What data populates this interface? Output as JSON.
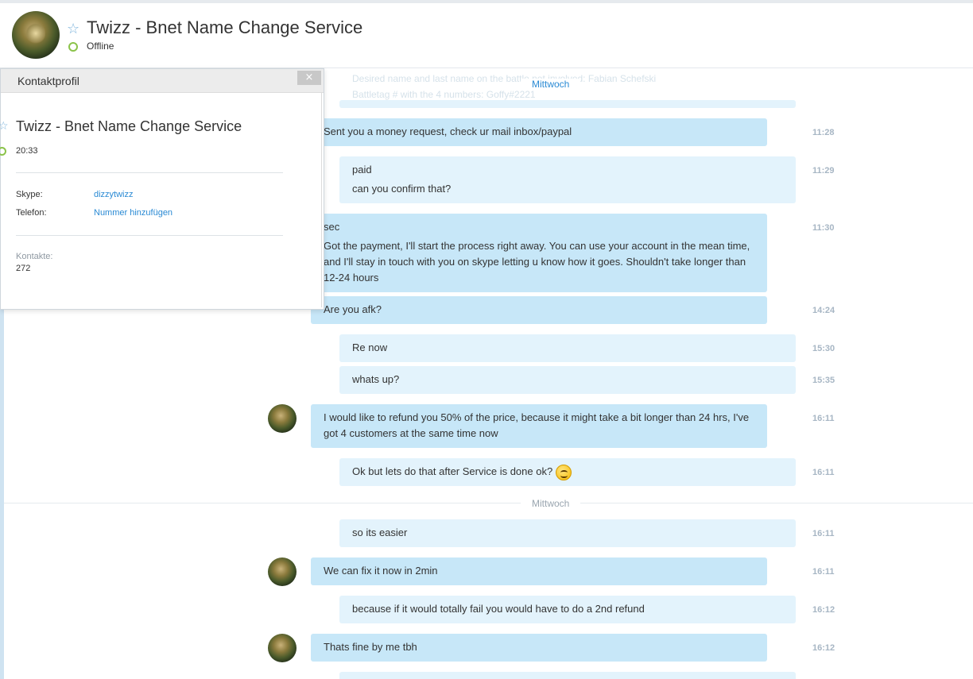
{
  "header": {
    "title": "Twizz - Bnet Name Change Service",
    "status": "Offline",
    "colors": {
      "presence": "#8bc34a",
      "star": "#7fb5dd"
    }
  },
  "profile": {
    "title": "Kontaktprofil",
    "close_label": "×",
    "name": "Twizz - Bnet Name Change Service",
    "local_time": "20:33",
    "skype_label": "Skype:",
    "skype_value": "dizzytwizz",
    "phone_label": "Telefon:",
    "phone_value": "Nummer hinzufügen",
    "contacts_label": "Kontakte:",
    "contacts_value": "272"
  },
  "chat": {
    "date_top": "Mittwoch",
    "date_mid": "Mittwoch",
    "faded_line1": "Desired name and last name on the battle.net involved: Fabian Schefski",
    "faded_line2": "Battletag # with the 4 numbers: Goffy#2221",
    "messages": [
      {
        "dir": "in",
        "lines": [
          "Sent you a money request, check ur mail inbox/paypal"
        ],
        "time": "11:28"
      },
      {
        "dir": "out",
        "lines": [
          "paid",
          "can you confirm that?"
        ],
        "time": "11:29"
      },
      {
        "dir": "in",
        "lines": [
          "sec",
          "Got the payment, I'll start the process right away. You can use your account in the mean time, and I'll stay in touch with you on skype letting u know how it goes. Shouldn't take longer than 12-24 hours"
        ],
        "time": "11:30"
      },
      {
        "dir": "in",
        "lines": [
          "Are you afk?"
        ],
        "time": "14:24"
      },
      {
        "dir": "out",
        "lines": [
          "Re now"
        ],
        "time": "15:30"
      },
      {
        "dir": "out",
        "lines": [
          "whats up?"
        ],
        "time": "15:35"
      },
      {
        "dir": "in",
        "lines": [
          "I would like to refund you 50% of the price, because it might take a bit longer than 24 hrs, I've got 4 customers at the same time now"
        ],
        "time": "16:11"
      },
      {
        "dir": "out",
        "lines": [
          "Ok but lets do that after Service is done ok?"
        ],
        "time": "16:11",
        "emoticon": "wink-smiley-icon"
      },
      {
        "dir": "out",
        "lines": [
          "so its easier"
        ],
        "time": "16:11"
      },
      {
        "dir": "in",
        "lines": [
          "We can fix it now in 2min"
        ],
        "time": "16:11"
      },
      {
        "dir": "out",
        "lines": [
          "because if it would totally fail you would have to do a 2nd refund"
        ],
        "time": "16:12"
      },
      {
        "dir": "in",
        "lines": [
          "Thats fine by me tbh"
        ],
        "time": "16:12"
      }
    ]
  }
}
